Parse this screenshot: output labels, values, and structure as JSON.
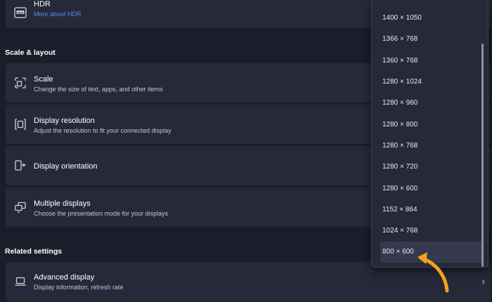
{
  "hdr": {
    "title": "HDR",
    "link": "More about HDR",
    "icon": "hdr-icon"
  },
  "scale_layout": {
    "heading": "Scale & layout",
    "items": [
      {
        "title": "Scale",
        "subtitle": "Change the size of text, apps, and other items",
        "icon": "scale-icon"
      },
      {
        "title": "Display resolution",
        "subtitle": "Adjust the resolution to fit your connected display",
        "icon": "resolution-icon"
      },
      {
        "title": "Display orientation",
        "subtitle": "",
        "icon": "orientation-icon"
      },
      {
        "title": "Multiple displays",
        "subtitle": "Choose the presentation mode for your displays",
        "icon": "multiple-displays-icon"
      }
    ]
  },
  "related": {
    "heading": "Related settings",
    "items": [
      {
        "title": "Advanced display",
        "subtitle": "Display information, refresh rate",
        "icon": "laptop-icon"
      }
    ]
  },
  "resolution_dropdown": {
    "options": [
      "1400 × 1050",
      "1366 × 768",
      "1360 × 768",
      "1280 × 1024",
      "1280 × 960",
      "1280 × 800",
      "1280 × 768",
      "1280 × 720",
      "1280 × 600",
      "1152 × 864",
      "1024 × 768",
      "800 × 600"
    ],
    "selected": "800 × 600"
  },
  "colors": {
    "background": "#1b1e2a",
    "card": "#262a38",
    "link": "#4c8cf5",
    "arrow": "#f5a01e"
  }
}
